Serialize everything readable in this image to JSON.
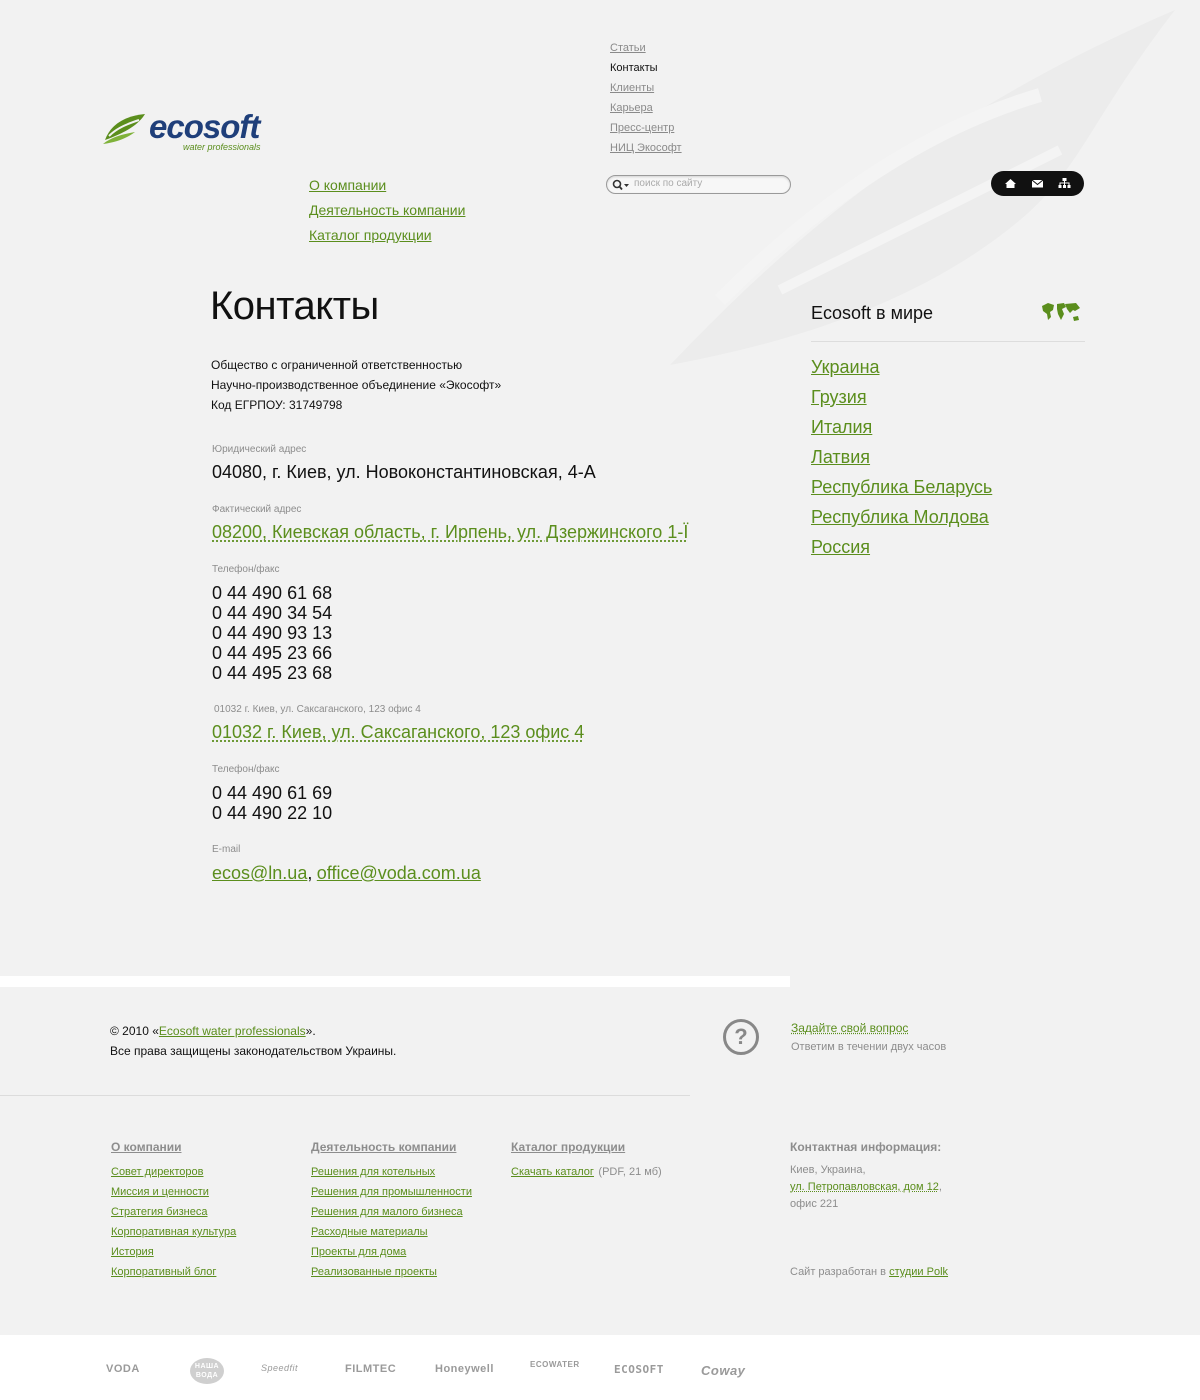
{
  "logo": {
    "word": "ecosoft",
    "tagline": "water professionals"
  },
  "top_nav": [
    {
      "label": "Статьи",
      "current": false
    },
    {
      "label": "Контакты",
      "current": true
    },
    {
      "label": "Клиенты",
      "current": false
    },
    {
      "label": "Карьера",
      "current": false
    },
    {
      "label": "Пресс-центр",
      "current": false
    },
    {
      "label": "НИЦ Экософт",
      "current": false
    }
  ],
  "main_nav": [
    "О компании",
    "Деятельность компании",
    "Каталог продукции"
  ],
  "search": {
    "placeholder": "поиск по сайту"
  },
  "icon_pill": [
    "home-icon",
    "mail-icon",
    "sitemap-icon"
  ],
  "page": {
    "title": "Контакты",
    "company": [
      "Общество с ограниченной ответственностью",
      "Научно-производственное объединение «Экософт»",
      "Код ЕГРПОУ: 31749798"
    ],
    "legal_label": "Юридический адрес",
    "legal_address": "04080, г. Киев, ул. Новоконстантиновская, 4-А",
    "actual_label": "Фактический адрес",
    "actual_address": "08200, Киевская область, г. Ирпень, ул. Дзержинского 1-Ї",
    "phone_label_1": "Телефон/факс",
    "phones_1": [
      "0 44 490 61 68",
      "0 44 490 34 54",
      "0 44 490 93 13",
      "0 44 495 23 66",
      "0 44 495 23 68"
    ],
    "office_label": "01032 г. Киев, ул. Саксаганского, 123 офис 4",
    "office_address": "01032 г. Киев, ул. Саксаганского, 123 офис 4",
    "phone_label_2": "Телефон/факс",
    "phones_2": [
      "0 44 490 61 69",
      "0 44 490 22 10"
    ],
    "email_label": "E-mail",
    "email_1": "ecos@ln.ua",
    "email_sep": ",",
    "email_2": "office@voda.com.ua"
  },
  "world": {
    "title": "Ecosoft в мире",
    "countries": [
      "Украина",
      "Грузия",
      "Италия",
      "Латвия",
      "Республика Беларусь",
      "Республика Молдова",
      "Россия"
    ]
  },
  "footer": {
    "copyright_prefix": "© 2010 «",
    "copyright_link": "Ecosoft water professionals",
    "copyright_suffix": "».",
    "rights": "Все права защищены законодательством Украины.",
    "ask_link": "Задайте свой вопрос",
    "ask_note": "Ответим в течении двух часов",
    "col1": {
      "title": "О компании",
      "items": [
        "Совет директоров",
        "Миссия и ценности",
        "Стратегия бизнеса",
        "Корпоративная культура",
        "История",
        "Корпоративный блог"
      ]
    },
    "col2": {
      "title": "Деятельность компании",
      "items": [
        "Решения для котельных",
        "Решения для промышленности",
        "Решения для малого бизнеса",
        "Расходные материалы",
        "Проекты для дома",
        "Реализованные проекты"
      ]
    },
    "col3": {
      "title": "Каталог продукции",
      "download": "Скачать каталог",
      "download_note": "(PDF, 21 мб)"
    },
    "contact": {
      "title": "Контактная информация:",
      "line1": "Киев, Украина,",
      "street": "ул. Петропавловская, дом 12",
      "street_suffix": ",",
      "line3": "офис 221"
    },
    "credit_prefix": "Сайт разработан в ",
    "credit_link": "студии Polk"
  },
  "partners": [
    "VODA",
    "НАША ВОДА",
    "Speedfit",
    "FILMTEC",
    "Honeywell",
    "ECOWATER",
    "ECOSOFT",
    "Coway"
  ]
}
